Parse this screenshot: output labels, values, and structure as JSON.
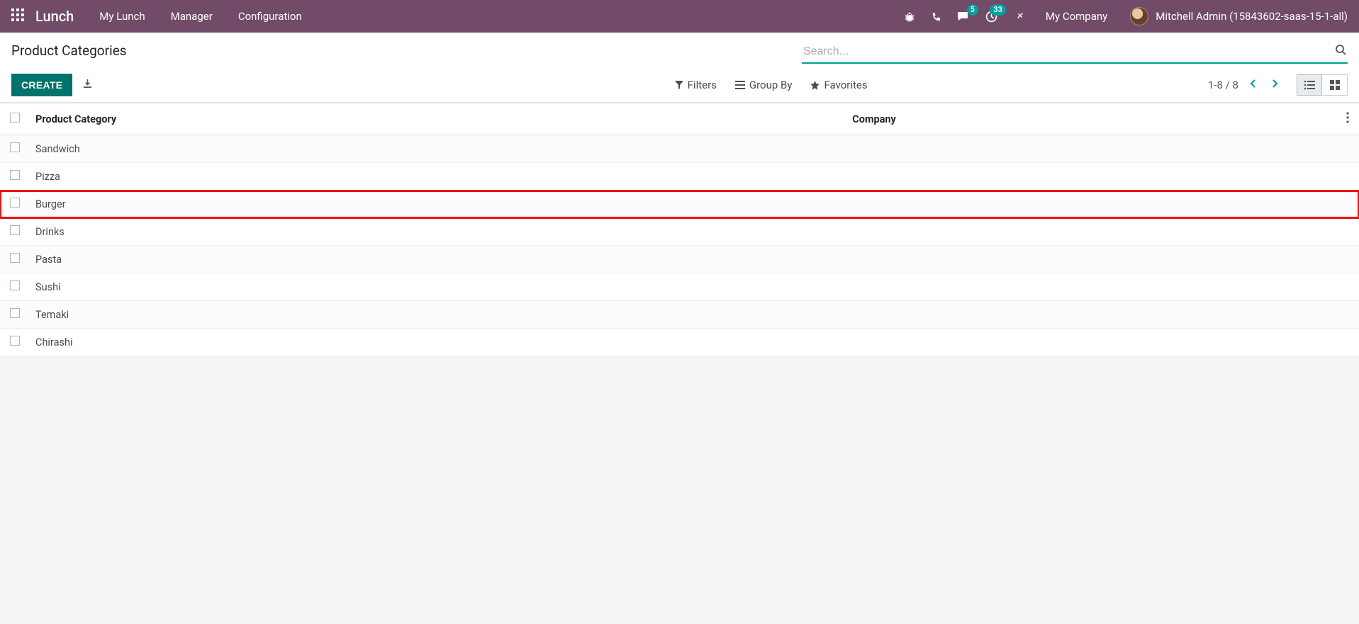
{
  "nav": {
    "app_name": "Lunch",
    "links": [
      "My Lunch",
      "Manager",
      "Configuration"
    ],
    "company": "My Company",
    "user_name": "Mitchell Admin (15843602-saas-15-1-all)",
    "badges": {
      "messages": "5",
      "activities": "33"
    }
  },
  "cp": {
    "title": "Product Categories",
    "create_label": "Create",
    "search_placeholder": "Search...",
    "filters_label": "Filters",
    "groupby_label": "Group By",
    "favorites_label": "Favorites",
    "pager": "1-8 / 8"
  },
  "table": {
    "columns": {
      "category": "Product Category",
      "company": "Company"
    },
    "rows": [
      {
        "category": "Sandwich",
        "company": ""
      },
      {
        "category": "Pizza",
        "company": ""
      },
      {
        "category": "Burger",
        "company": ""
      },
      {
        "category": "Drinks",
        "company": ""
      },
      {
        "category": "Pasta",
        "company": ""
      },
      {
        "category": "Sushi",
        "company": ""
      },
      {
        "category": "Temaki",
        "company": ""
      },
      {
        "category": "Chirashi",
        "company": ""
      }
    ],
    "highlighted_index": 2
  }
}
